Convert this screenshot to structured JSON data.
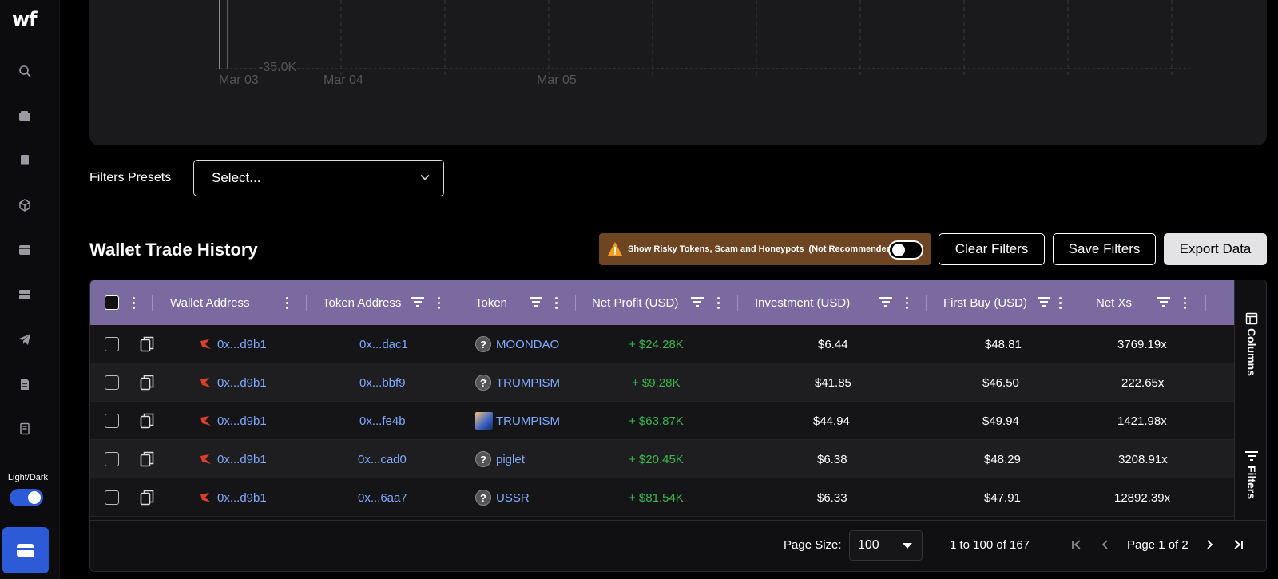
{
  "sidebar": {
    "logo": "wf",
    "theme_label": "Light/Dark"
  },
  "chart": {
    "y_tick": "-35.0K",
    "x_ticks": [
      "Mar 03",
      "Mar 04",
      "Mar 05"
    ]
  },
  "filters": {
    "presets_label": "Filters Presets",
    "presets_value": "Select..."
  },
  "toolbar": {
    "title": "Wallet Trade History",
    "risky_text": "Show Risky Tokens, Scam and Honeypots",
    "risky_note": "(Not Recommended)",
    "clear_label": "Clear Filters",
    "save_label": "Save Filters",
    "export_label": "Export Data"
  },
  "table": {
    "columns": [
      "Wallet Address",
      "Token Address",
      "Token",
      "Net Profit (USD)",
      "Investment (USD)",
      "First Buy (USD)",
      "Net Xs"
    ],
    "rows": [
      {
        "wallet": "0x...d9b1",
        "token_address": "0x...dac1",
        "token": "MOONDAO",
        "token_icon": "question-icon",
        "net_profit": "+ $24.28K",
        "investment": "$6.44",
        "first_buy": "$48.81",
        "net_xs": "3769.19x"
      },
      {
        "wallet": "0x...d9b1",
        "token_address": "0x...bbf9",
        "token": "TRUMPISM",
        "token_icon": "question-icon",
        "net_profit": "+ $9.28K",
        "investment": "$41.85",
        "first_buy": "$46.50",
        "net_xs": "222.65x"
      },
      {
        "wallet": "0x...d9b1",
        "token_address": "0x...fe4b",
        "token": "TRUMPISM",
        "token_icon": "token-image-icon",
        "net_profit": "+ $63.87K",
        "investment": "$44.94",
        "first_buy": "$49.94",
        "net_xs": "1421.98x"
      },
      {
        "wallet": "0x...d9b1",
        "token_address": "0x...cad0",
        "token": "piglet",
        "token_icon": "question-icon",
        "net_profit": "+ $20.45K",
        "investment": "$6.38",
        "first_buy": "$48.29",
        "net_xs": "3208.91x"
      },
      {
        "wallet": "0x...d9b1",
        "token_address": "0x...6aa7",
        "token": "USSR",
        "token_icon": "question-icon",
        "net_profit": "+ $81.54K",
        "investment": "$6.33",
        "first_buy": "$47.91",
        "net_xs": "12892.39x"
      }
    ],
    "side_tabs": [
      "Columns",
      "Filters"
    ]
  },
  "pagination": {
    "page_size_label": "Page Size:",
    "page_size": "100",
    "range": "1 to 100 of 167",
    "page_info": "Page 1 of 2"
  },
  "colors": {
    "header_bg": "#7a6aa0",
    "link": "#7fa9ff",
    "profit": "#3ab74f",
    "accent": "#2d5bd8",
    "warning_bg": "#6e4522"
  }
}
